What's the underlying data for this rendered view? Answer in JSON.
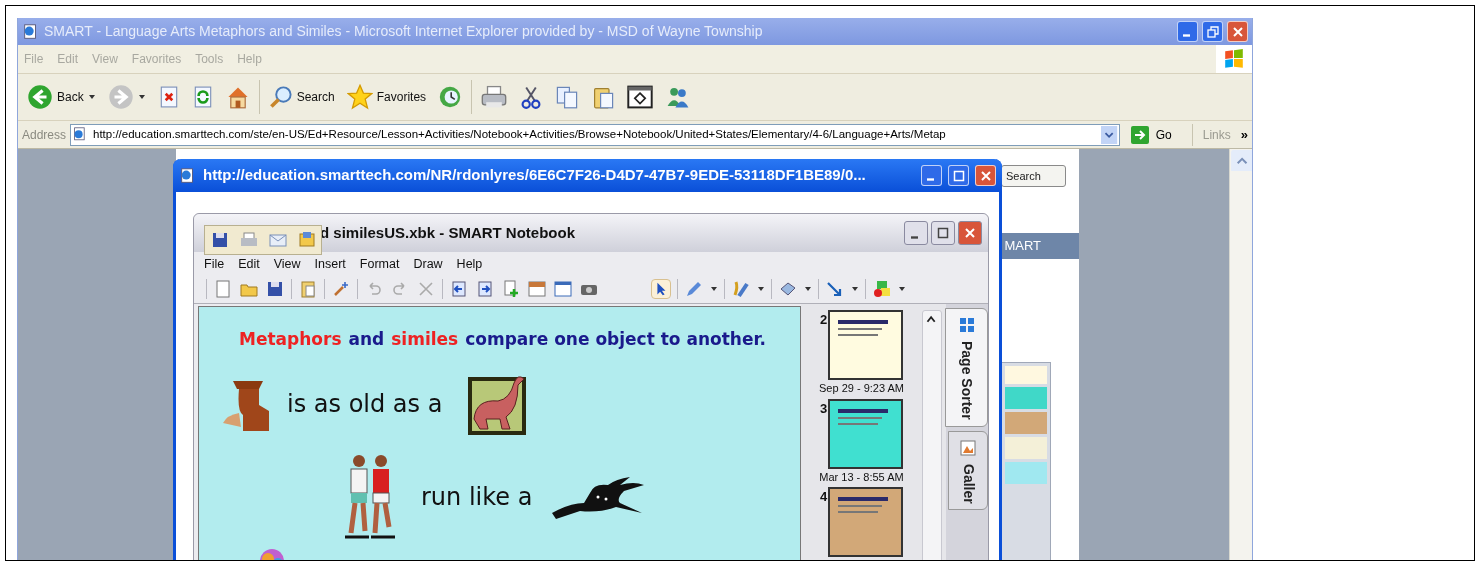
{
  "browser": {
    "title": "SMART - Language Arts Metaphors and Similes - Microsoft Internet Explorer provided by  - MSD of Wayne Township",
    "menu": [
      "File",
      "Edit",
      "View",
      "Favorites",
      "Tools",
      "Help"
    ],
    "toolbar": [
      {
        "kind": "back",
        "label": "Back"
      },
      {
        "kind": "forward"
      },
      {
        "kind": "stop"
      },
      {
        "kind": "refresh"
      },
      {
        "kind": "home"
      },
      {
        "kind": "search",
        "label": "Search"
      },
      {
        "kind": "favorites",
        "label": "Favorites"
      },
      {
        "kind": "history"
      },
      {
        "kind": "print"
      },
      {
        "kind": "cut"
      },
      {
        "kind": "copy"
      },
      {
        "kind": "paste"
      },
      {
        "kind": "edit"
      },
      {
        "kind": "messenger"
      }
    ],
    "address": {
      "label": "Address",
      "url": "http://education.smarttech.com/ste/en-US/Ed+Resource/Lesson+Activities/Notebook+Activities/Browse+Notebook/United+States/Elementary/4-6/Language+Arts/Metap",
      "go": "Go",
      "links": "Links",
      "chevron": "»"
    }
  },
  "page": {
    "search_button": "Search",
    "nav_text": "MART"
  },
  "popup": {
    "title": "http://education.smarttech.com/NR/rdonlyres/6E6C7F26-D4D7-47B7-9EDE-53118DF1BE89/0..."
  },
  "notebook": {
    "title": "d similesUS.xbk - SMART Notebook",
    "menu": [
      "File",
      "Edit",
      "View",
      "Insert",
      "Format",
      "Draw",
      "Help"
    ],
    "canvas": {
      "heading": [
        {
          "text": "Metaphors",
          "color": "#ee2222"
        },
        {
          "text": "and",
          "color": "#1a1a8c"
        },
        {
          "text": "similes",
          "color": "#ee2222"
        },
        {
          "text": "compare one object to another.",
          "color": "#1a1a8c"
        }
      ],
      "lines": [
        "is as old as a",
        "run like a"
      ]
    },
    "pages": [
      {
        "number": "2",
        "date": "Sep 29 - 9:23 AM",
        "color": "#fffbe0"
      },
      {
        "number": "3",
        "date": "Mar 13 - 8:55 AM",
        "color": "#40e0d0"
      },
      {
        "number": "4",
        "color": "#d2a878"
      }
    ],
    "tabs": [
      {
        "label": "Page Sorter",
        "selected": true
      },
      {
        "label": "Galler",
        "selected": false
      }
    ]
  }
}
